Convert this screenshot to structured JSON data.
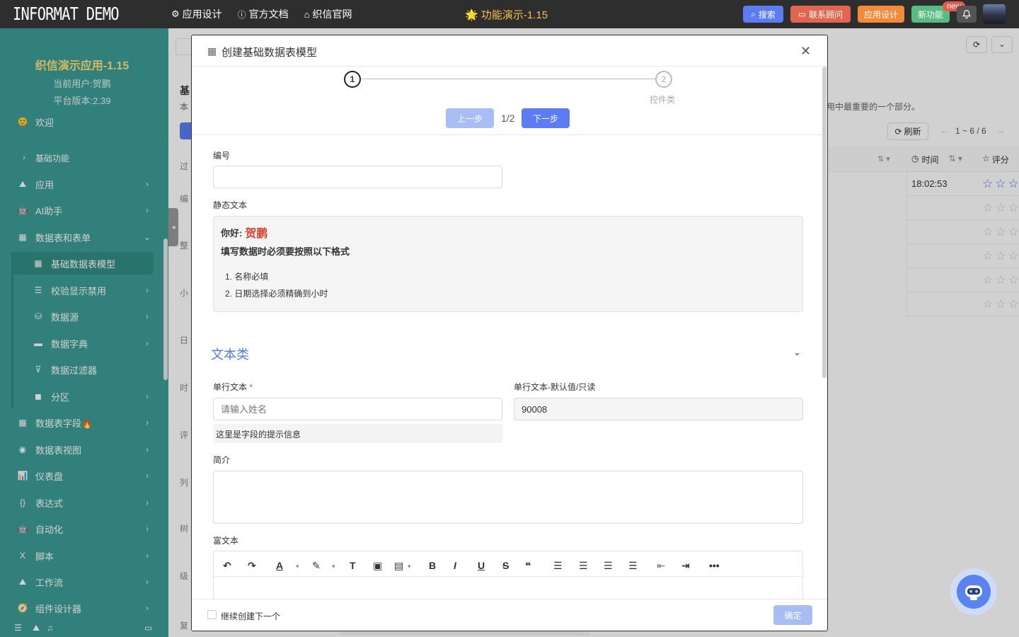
{
  "topbar": {
    "logo": "INFORMAT DEMO",
    "nav": [
      {
        "icon": "gear-icon",
        "label": "应用设计"
      },
      {
        "icon": "info-icon",
        "label": "官方文档"
      },
      {
        "icon": "home-icon",
        "label": "织信官网"
      }
    ],
    "center_title": "🌟 功能演示-1.15",
    "buttons": {
      "search": "搜索",
      "consult": "联系顾问",
      "app_design": "应用设计",
      "new_feature": "新功能",
      "new_badge": "new"
    },
    "colors": {
      "search": "#5b7cf2",
      "consult": "#e0664f",
      "app_design": "#f08a3c",
      "new_feature": "#58bb82"
    }
  },
  "sidebar": {
    "app_name": "织信演示应用-1.15",
    "current_user": "当前用户:贺鹏",
    "platform_version": "平台版本:2.39",
    "items": [
      {
        "icon": "smile-icon",
        "label": "欢迎",
        "arrow": ""
      },
      {
        "icon": "chevron-right-icon",
        "label": "基础功能",
        "arrow": ""
      },
      {
        "icon": "rocket-icon",
        "label": "应用",
        "arrow": "›"
      },
      {
        "icon": "robot-icon",
        "label": "AI助手",
        "arrow": "›"
      },
      {
        "icon": "table-icon",
        "label": "数据表和表单",
        "arrow": "⌄"
      },
      {
        "icon": "table-icon",
        "label": "基础数据表模型",
        "arrow": ""
      },
      {
        "icon": "sliders-icon",
        "label": "校验显示禁用",
        "arrow": "›"
      },
      {
        "icon": "database-icon",
        "label": "数据源",
        "arrow": "›"
      },
      {
        "icon": "book-icon",
        "label": "数据字典",
        "arrow": "›"
      },
      {
        "icon": "filter-icon",
        "label": "数据过滤器",
        "arrow": ""
      },
      {
        "icon": "partition-icon",
        "label": "分区",
        "arrow": "›"
      },
      {
        "icon": "grid-icon",
        "label": "数据表字段🔥",
        "arrow": "›"
      },
      {
        "icon": "view-icon",
        "label": "数据表视图",
        "arrow": "›"
      },
      {
        "icon": "dashboard-icon",
        "label": "仪表盘",
        "arrow": "›"
      },
      {
        "icon": "braces-icon",
        "label": "表达式",
        "arrow": "›"
      },
      {
        "icon": "robot-icon",
        "label": "自动化",
        "arrow": "›"
      },
      {
        "icon": "script-icon",
        "label": "脚本",
        "arrow": "›"
      },
      {
        "icon": "workflow-icon",
        "label": "工作流",
        "arrow": "›"
      },
      {
        "icon": "compass-icon",
        "label": "组件设计器",
        "arrow": "›"
      }
    ]
  },
  "background": {
    "title_fragment": "基",
    "desc_fragment": "本",
    "desc_tail": "用中最重要的一个部分。",
    "filter_label": "过",
    "field_labels": [
      "编",
      "整",
      "小",
      "日",
      "时",
      "评",
      "列",
      "树",
      "级",
      "复"
    ],
    "refresh": "刷新",
    "pagination": "1 ~ 6 / 6",
    "col_time": "时间",
    "col_rating": "评分",
    "first_time": "18:02:53"
  },
  "modal": {
    "title": "创建基础数据表模型",
    "step1": "1",
    "step2": "2",
    "step2_label": "控件类",
    "prev": "上一步",
    "page": "1/2",
    "next": "下一步",
    "field_id_label": "编号",
    "static_text_label": "静态文本",
    "greeting": "你好:",
    "user_name": "贺鹏",
    "format_title": "填写数据时必须要按照以下格式",
    "rules": [
      "1. 名称必填",
      "2. 日期选择必须精确到小时"
    ],
    "section_title": "文本类",
    "single_text_label": "单行文本",
    "required_mark": "*",
    "single_text_placeholder": "请输入姓名",
    "hint": "这里是字段的提示信息",
    "readonly_label": "单行文本-默认值/只读",
    "readonly_value": "90008",
    "intro_label": "简介",
    "rich_text_label": "富文本",
    "continue_label": "继续创建下一个",
    "confirm": "确定"
  }
}
